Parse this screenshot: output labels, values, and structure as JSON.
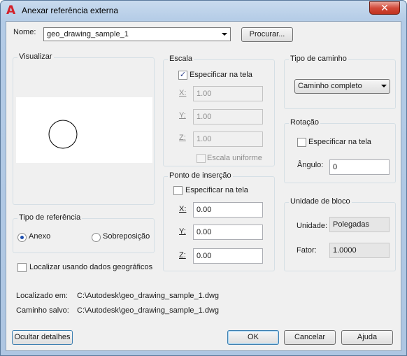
{
  "window": {
    "title": "Anexar referência externa",
    "close_glyph": "✕",
    "logo_glyph": "A"
  },
  "name": {
    "label": "Nome:",
    "value": "geo_drawing_sample_1",
    "browse_label": "Procurar..."
  },
  "preview": {
    "title": "Visualizar"
  },
  "ref_type": {
    "title": "Tipo de referência",
    "attach_label": "Anexo",
    "overlay_label": "Sobreposição",
    "selected": "attach"
  },
  "geo_locate": {
    "label": "Localizar usando dados geográficos",
    "checked": false
  },
  "scale": {
    "title": "Escala",
    "specify_label": "Especificar na tela",
    "specify_checked": true,
    "x_label": "X:",
    "x_value": "1.00",
    "y_label": "Y:",
    "y_value": "1.00",
    "z_label": "Z:",
    "z_value": "1.00",
    "uniform_label": "Escala uniforme",
    "uniform_checked": false
  },
  "insertion": {
    "title": "Ponto de inserção",
    "specify_label": "Especificar na tela",
    "specify_checked": false,
    "x_label": "X:",
    "x_value": "0.00",
    "y_label": "Y:",
    "y_value": "0.00",
    "z_label": "Z:",
    "z_value": "0.00"
  },
  "path_type": {
    "title": "Tipo de caminho",
    "value": "Caminho completo"
  },
  "rotation": {
    "title": "Rotação",
    "specify_label": "Especificar na tela",
    "specify_checked": false,
    "angle_label": "Ângulo:",
    "angle_value": "0"
  },
  "block_unit": {
    "title": "Unidade de bloco",
    "unit_label": "Unidade:",
    "unit_value": "Polegadas",
    "factor_label": "Fator:",
    "factor_value": "1.0000"
  },
  "paths": {
    "found_label": "Localizado em:",
    "found_value": "C:\\Autodesk\\geo_drawing_sample_1.dwg",
    "saved_label": "Caminho salvo:",
    "saved_value": "C:\\Autodesk\\geo_drawing_sample_1.dwg"
  },
  "buttons": {
    "hide_details": "Ocultar detalhes",
    "ok": "OK",
    "cancel": "Cancelar",
    "help": "Ajuda"
  },
  "check_glyph": "✓"
}
